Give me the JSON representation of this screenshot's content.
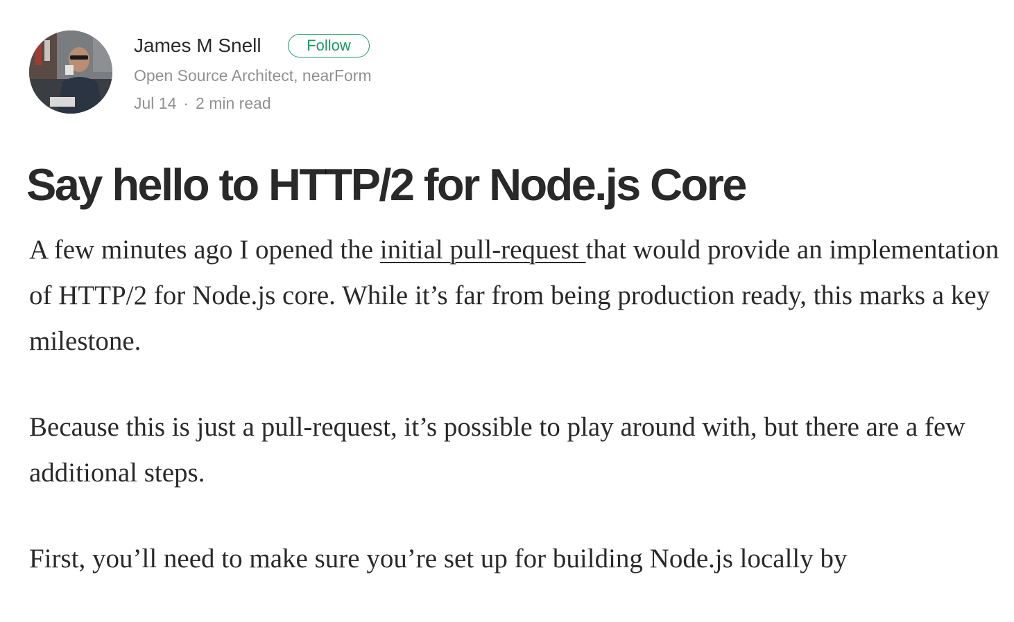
{
  "author": {
    "name": "James M Snell",
    "follow_label": "Follow",
    "bio": "Open Source Architect, nearForm",
    "date": "Jul 14",
    "separator": "·",
    "read_time": "2 min read"
  },
  "post": {
    "title": "Say hello to HTTP/2 for Node.js Core",
    "paragraph1": {
      "before_link": "A few minutes ago I opened the ",
      "link_text": "initial pull-request ",
      "after_link": "that would provide an implementation of HTTP/2 for Node.js core. While it’s far from being production ready, this marks a key milestone."
    },
    "paragraph2": "Because this is just a pull-request, it’s possible to play around with, but there are a few additional steps.",
    "paragraph3": "First, you’ll need to make sure you’re set up for building Node.js locally by"
  },
  "colors": {
    "accent": "#1c9963",
    "text": "rgba(0,0,0,0.84)",
    "muted": "rgba(0,0,0,0.44)"
  }
}
